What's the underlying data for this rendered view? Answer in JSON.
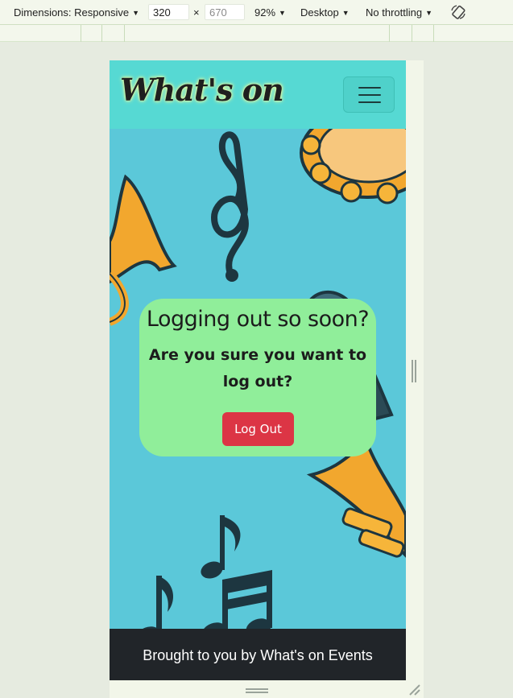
{
  "devtools": {
    "dimensions_label": "Dimensions: Responsive",
    "width": "320",
    "height": "670",
    "times": "×",
    "zoom": "92%",
    "device_mode": "Desktop",
    "throttling": "No throttling"
  },
  "site": {
    "brand": "What's on",
    "card_title": "Logging out so soon?",
    "card_question": "Are you sure you want to log out?",
    "logout_label": "Log Out",
    "footer_text": "Brought to you by What's on Events"
  },
  "colors": {
    "header": "#56d9d3",
    "hero_bg": "#5bc8d9",
    "card": "#90ee9a",
    "logout_button": "#dc3545",
    "footer": "#212529"
  }
}
